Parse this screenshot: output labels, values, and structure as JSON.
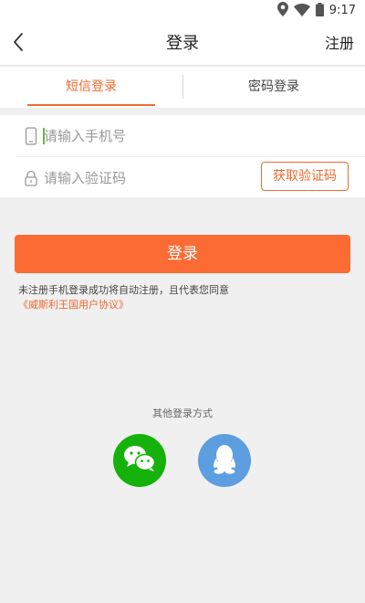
{
  "status_bar": {
    "time": "9:17",
    "icons": [
      "location-icon",
      "wifi-icon",
      "battery-icon"
    ]
  },
  "navbar": {
    "title": "登录",
    "register_label": "注册",
    "back_icon": "chevron-left-icon"
  },
  "tabs": [
    {
      "label": "短信登录",
      "active": true
    },
    {
      "label": "密码登录",
      "active": false
    }
  ],
  "form": {
    "phone": {
      "placeholder": "请输入手机号",
      "value": "",
      "icon": "phone-icon"
    },
    "code": {
      "placeholder": "请输入验证码",
      "value": "",
      "icon": "lock-icon"
    },
    "get_code_label": "获取验证码"
  },
  "login_button": "登录",
  "agreement": {
    "text": "未注册手机登录成功将自动注册，且代表您同意",
    "link": "《威斯利王国用户协议》"
  },
  "other_login": {
    "title": "其他登录方式",
    "methods": [
      {
        "name": "wechat",
        "icon": "wechat-icon",
        "color": "#15b20b"
      },
      {
        "name": "qq",
        "icon": "qq-icon",
        "color": "#5c9ee0"
      }
    ]
  },
  "colors": {
    "accent": "#fd6b34",
    "tab_active": "#f0692f",
    "background": "#f0f0f0"
  }
}
